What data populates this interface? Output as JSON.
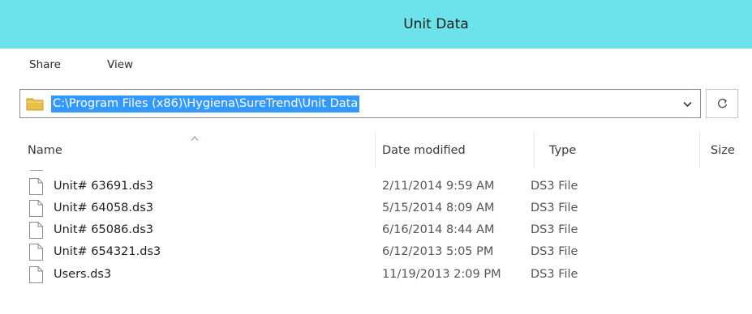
{
  "window": {
    "title": "Unit Data"
  },
  "ribbon": {
    "tabs": [
      {
        "label": "Share"
      },
      {
        "label": "View"
      }
    ]
  },
  "address": {
    "path": "C:\\Program Files (x86)\\Hygiena\\SureTrend\\Unit Data"
  },
  "columns": {
    "name": "Name",
    "date": "Date modified",
    "type": "Type",
    "size": "Size"
  },
  "files": [
    {
      "name": "Unit# 63691.ds3",
      "date": "2/11/2014 9:59 AM",
      "type": "DS3 File"
    },
    {
      "name": "Unit# 64058.ds3",
      "date": "5/15/2014 8:09 AM",
      "type": "DS3 File"
    },
    {
      "name": "Unit# 65086.ds3",
      "date": "6/16/2014 8:44 AM",
      "type": "DS3 File"
    },
    {
      "name": "Unit# 654321.ds3",
      "date": "6/12/2013 5:05 PM",
      "type": "DS3 File"
    },
    {
      "name": "Users.ds3",
      "date": "11/19/2013 2:09 PM",
      "type": "DS3 File"
    }
  ],
  "colors": {
    "titlebar": "#6ce3eb",
    "selection": "#3399ff",
    "folder": "#e8c04a"
  },
  "icons": [
    "folder-icon",
    "chevron-down-icon",
    "refresh-icon",
    "sort-ascending-icon",
    "file-icon"
  ]
}
